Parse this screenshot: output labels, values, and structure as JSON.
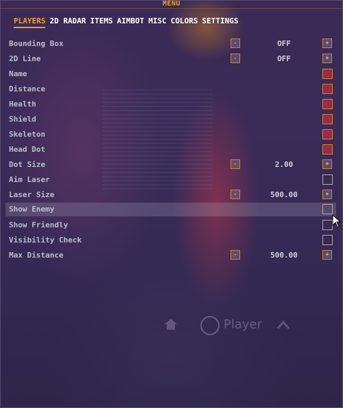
{
  "menu": {
    "title": "MENU"
  },
  "tabs": [
    {
      "label": "PLAYERS",
      "active": true
    },
    {
      "label": "2D RADAR",
      "active": false
    },
    {
      "label": "ITEMS",
      "active": false
    },
    {
      "label": "AIMBOT",
      "active": false
    },
    {
      "label": "MISC",
      "active": false
    },
    {
      "label": "COLORS",
      "active": false
    },
    {
      "label": "SETTINGS",
      "active": false
    }
  ],
  "settings": {
    "bounding_box": {
      "label": "Bounding Box",
      "value": "OFF",
      "minus": "-",
      "plus": "+"
    },
    "line_2d": {
      "label": "2D Line",
      "value": "OFF",
      "minus": "-",
      "plus": "+"
    },
    "name": {
      "label": "Name",
      "checked": true
    },
    "distance": {
      "label": "Distance",
      "checked": true
    },
    "health": {
      "label": "Health",
      "checked": true
    },
    "shield": {
      "label": "Shield",
      "checked": true
    },
    "skeleton": {
      "label": "Skeleton",
      "checked": true
    },
    "head_dot": {
      "label": "Head Dot",
      "checked": true
    },
    "dot_size": {
      "label": "Dot Size",
      "value": "2.00",
      "minus": "-",
      "plus": "+"
    },
    "aim_laser": {
      "label": "Aim Laser",
      "checked": false
    },
    "laser_size": {
      "label": "Laser Size",
      "value": "500.00",
      "minus": "-",
      "plus": "+"
    },
    "show_enemy": {
      "label": "Show Enemy",
      "checked": false,
      "highlighted": true
    },
    "show_friendly": {
      "label": "Show Friendly",
      "checked": false
    },
    "visibility_check": {
      "label": "Visibility Check",
      "checked": false
    },
    "max_distance": {
      "label": "Max Distance",
      "value": "500.00",
      "minus": "-",
      "plus": "+"
    }
  },
  "background": {
    "player_text": "Player"
  },
  "colors": {
    "accent": "#f0a020",
    "checked": "#9a2a4a",
    "label": "#bdbdd0"
  }
}
